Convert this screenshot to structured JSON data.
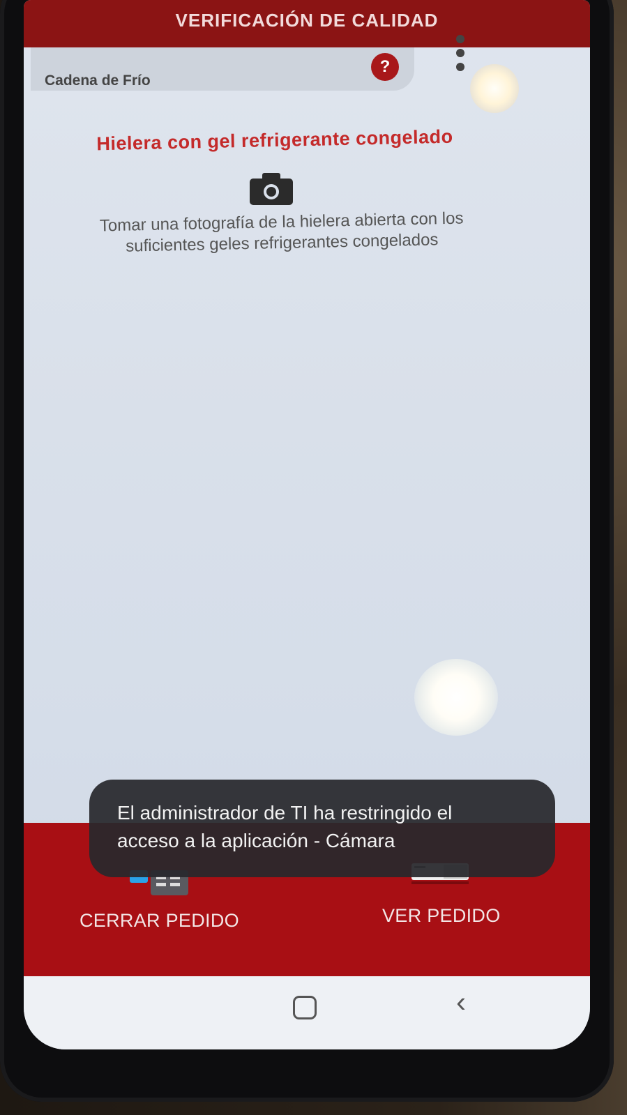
{
  "app": {
    "title": "VERIFICACIÓN DE CALIDAD"
  },
  "toolbar": {
    "section_label": "Cadena de Frío",
    "help_icon": "question-icon",
    "help_label": "?",
    "more_icon": "more-vert-icon"
  },
  "content": {
    "title": "Hielera con gel refrigerante congelado",
    "camera_icon": "camera-icon",
    "instruction_line1": "Tomar una fotografía de la hielera abierta con los",
    "instruction_line2": "suficientes geles refrigerantes congelados"
  },
  "bottom_nav": {
    "close_order_label": "CERRAR PEDIDO",
    "view_order_label": "VER PEDIDO"
  },
  "toast": {
    "line1": "El administrador de TI ha restringido el",
    "line2": "acceso a la aplicación - Cámara"
  },
  "colors": {
    "brand_red": "#a80f14",
    "header_red": "#8b1414",
    "title_red": "#c42a2a"
  }
}
